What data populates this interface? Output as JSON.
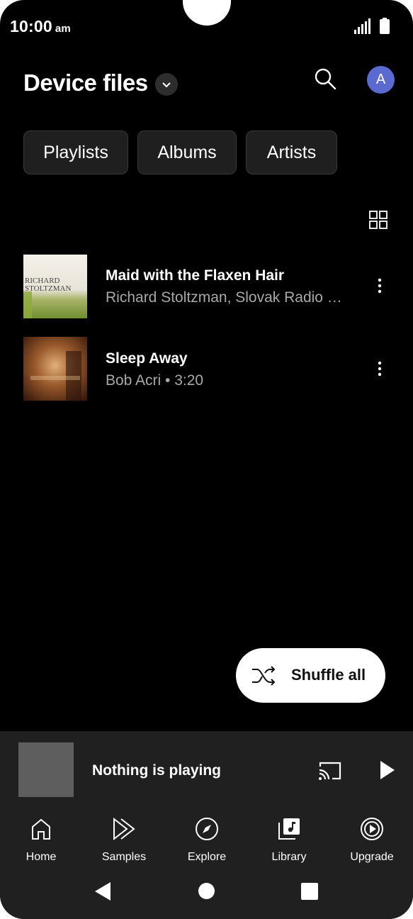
{
  "status_bar": {
    "time": "10:00",
    "ampm": "am"
  },
  "header": {
    "title": "Device files",
    "avatar_letter": "A"
  },
  "chips": [
    "Playlists",
    "Albums",
    "Artists"
  ],
  "songs": [
    {
      "title": "Maid with the Flaxen Hair",
      "subtitle": "Richard Stoltzman, Slovak Radio …",
      "art_text_1": "RICHARD",
      "art_text_2": "STOLTZMAN"
    },
    {
      "title": "Sleep Away",
      "subtitle": "Bob Acri • 3:20"
    }
  ],
  "shuffle": {
    "label": "Shuffle all"
  },
  "mini_player": {
    "status": "Nothing is playing"
  },
  "nav": [
    {
      "label": "Home",
      "icon": "home-icon"
    },
    {
      "label": "Samples",
      "icon": "samples-icon"
    },
    {
      "label": "Explore",
      "icon": "compass-icon"
    },
    {
      "label": "Library",
      "icon": "library-icon"
    },
    {
      "label": "Upgrade",
      "icon": "upgrade-icon"
    }
  ],
  "colors": {
    "background": "#000000",
    "surface": "#202020",
    "chip": "#1f1f1f",
    "avatar": "#5b6ad0",
    "secondary_text": "#a8a8a8"
  }
}
